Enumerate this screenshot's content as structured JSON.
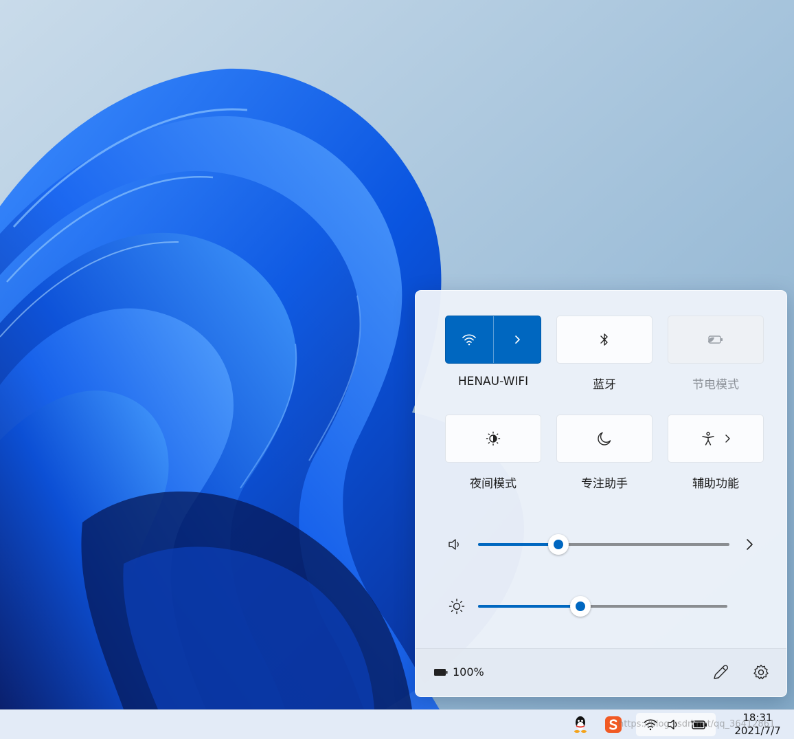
{
  "quick_settings": {
    "tiles": [
      {
        "id": "wifi",
        "label": "HENAU-WIFI",
        "icon": "wifi-icon",
        "state": "on"
      },
      {
        "id": "bluetooth",
        "label": "蓝牙",
        "icon": "bluetooth-icon",
        "state": "off"
      },
      {
        "id": "battery-saver",
        "label": "节电模式",
        "icon": "battery-saver-icon",
        "state": "disabled"
      },
      {
        "id": "night-light",
        "label": "夜间模式",
        "icon": "night-light-icon",
        "state": "off"
      },
      {
        "id": "focus-assist",
        "label": "专注助手",
        "icon": "moon-icon",
        "state": "off"
      },
      {
        "id": "accessibility",
        "label": "辅助功能",
        "icon": "accessibility-icon",
        "state": "off"
      }
    ],
    "volume": {
      "icon": "speaker-icon",
      "level": 0.32
    },
    "brightness": {
      "icon": "sun-icon",
      "level": 0.41
    },
    "battery": {
      "icon": "battery-icon",
      "percent": "100%"
    },
    "footer_icons": [
      "edit-icon",
      "gear-icon"
    ]
  },
  "taskbar": {
    "tray_icons": [
      "qq-icon",
      "sogou-ime-icon",
      "wifi-icon",
      "speaker-icon",
      "battery-charging-icon"
    ],
    "time": "18:31",
    "date": "2021/7/7"
  },
  "watermark": "https://blog.csdn.net/qq_36412861",
  "colors": {
    "accent": "#0067c0",
    "panel_bg": "#ecf2f9",
    "taskbar_bg": "#e3ebf7"
  }
}
